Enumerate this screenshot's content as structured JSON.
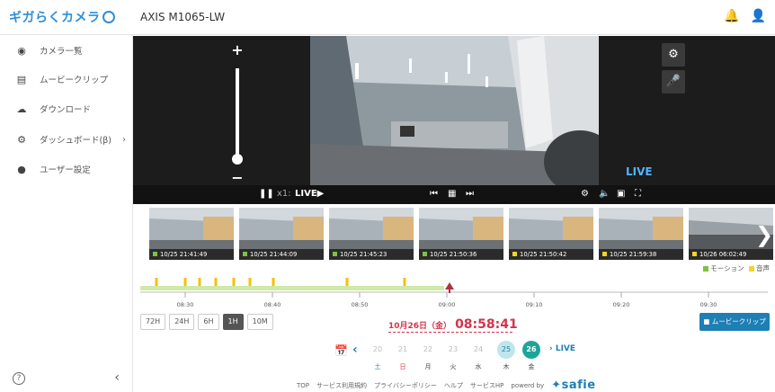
{
  "app": {
    "brand": "ギガらくカメラ",
    "camera_name": "AXIS M1065-LW"
  },
  "sidebar": {
    "items": [
      {
        "label": "カメラ一覧",
        "icon": "camera-icon"
      },
      {
        "label": "ムービークリップ",
        "icon": "film-icon"
      },
      {
        "label": "ダウンロード",
        "icon": "download-cloud-icon"
      },
      {
        "label": "ダッシュボード(β)",
        "icon": "dashboard-icon"
      },
      {
        "label": "ユーザー設定",
        "icon": "user-icon"
      }
    ]
  },
  "player": {
    "live_badge": "LIVE",
    "speed": "x1:",
    "live_label": "LIVE"
  },
  "thumbnails": [
    {
      "time": "10/25 21:41:49",
      "type": "motion"
    },
    {
      "time": "10/25 21:44:09",
      "type": "motion"
    },
    {
      "time": "10/25 21:45:23",
      "type": "motion"
    },
    {
      "time": "10/25 21:50:36",
      "type": "motion"
    },
    {
      "time": "10/25 21:50:42",
      "type": "sound"
    },
    {
      "time": "10/25 21:59:38",
      "type": "sound"
    },
    {
      "time": "10/26 06:02:49",
      "type": "sound"
    }
  ],
  "legend": {
    "motion": "モーション",
    "sound": "音声"
  },
  "timeline": {
    "ticks": [
      "08:30",
      "08:40",
      "08:50",
      "09:00",
      "09:10",
      "09:20",
      "09:30"
    ]
  },
  "range_buttons": [
    "72H",
    "24H",
    "6H",
    "1H",
    "10M"
  ],
  "range_active": "1H",
  "current": {
    "date": "10月26日（金）",
    "time": "08:58:41"
  },
  "clip_button": "ムービークリップ",
  "datepicker": {
    "days": [
      "20",
      "21",
      "22",
      "23",
      "24",
      "25",
      "26"
    ],
    "weekdays": [
      "土",
      "日",
      "月",
      "火",
      "水",
      "木",
      "金"
    ],
    "live_link": "LIVE"
  },
  "footer": {
    "links": [
      "TOP",
      "サービス利用規約",
      "プライバシーポリシー",
      "ヘルプ",
      "サービスHP"
    ],
    "powered_by": "powerd by",
    "logo": "safie"
  },
  "colors": {
    "motion": "#7dc242",
    "sound": "#f5d328",
    "accent": "#1e7fb5",
    "date_red": "#d2344c"
  }
}
